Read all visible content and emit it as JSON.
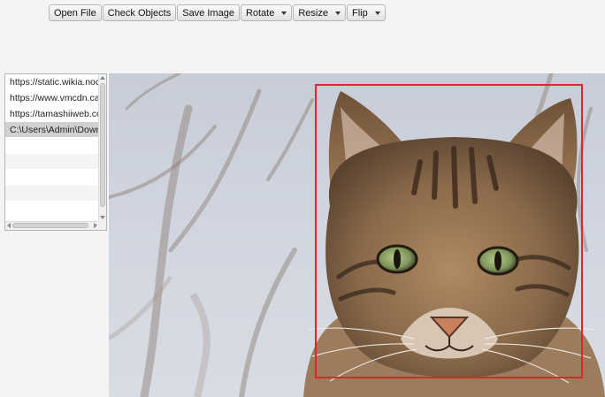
{
  "toolbar": {
    "open_file": "Open File",
    "check_objects": "Check Objects",
    "save_image": "Save Image",
    "rotate": "Rotate",
    "resize": "Resize",
    "flip": "Flip"
  },
  "file_list": {
    "items": [
      "https://static.wikia.nocookie.net",
      "https://www.vmcdn.ca/f/",
      "https://tamashiiweb.com",
      "C:\\Users\\Admin\\Downloads"
    ],
    "selected_index": 3
  },
  "detection": {
    "box_color": "#e3242b"
  }
}
